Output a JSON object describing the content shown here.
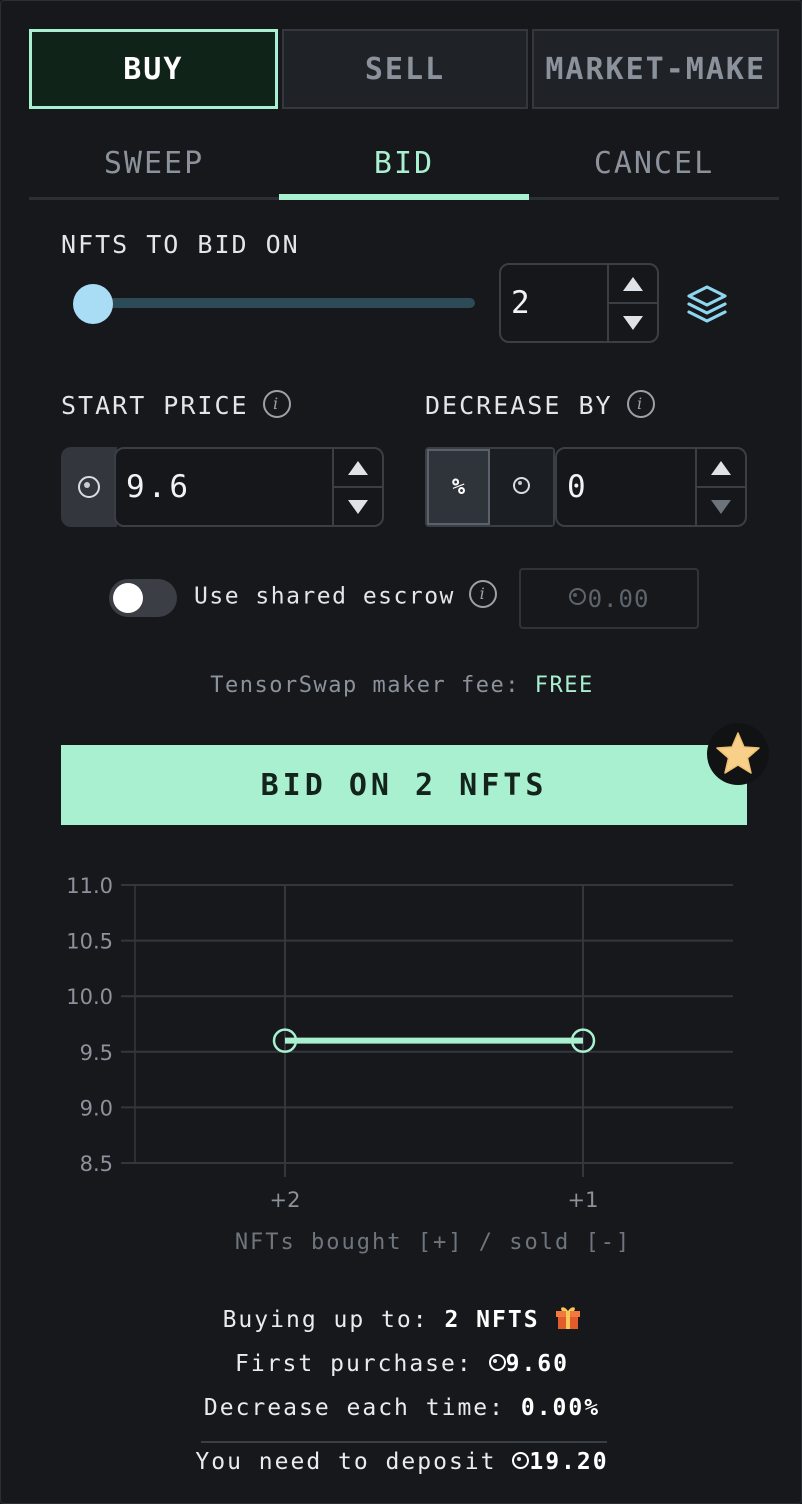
{
  "mode_tabs": [
    {
      "label": "BUY",
      "active": true
    },
    {
      "label": "SELL",
      "active": false
    },
    {
      "label": "MARKET-MAKE",
      "active": false
    }
  ],
  "sub_tabs": [
    {
      "label": "SWEEP",
      "active": false
    },
    {
      "label": "BID",
      "active": true
    },
    {
      "label": "CANCEL",
      "active": false
    }
  ],
  "nfts_to_bid": {
    "label": "NFTS TO BID ON",
    "value": "2",
    "slider_fraction": 0.0
  },
  "start_price": {
    "label": "START PRICE",
    "currency_icon": "sol-icon",
    "value": "9.6"
  },
  "decrease_by": {
    "label": "DECREASE BY",
    "percent_option": "%",
    "selected": "%",
    "value": "0"
  },
  "escrow": {
    "label": "Use shared escrow",
    "enabled": false,
    "placeholder": "0.00"
  },
  "fee": {
    "prefix": "TensorSwap maker fee:",
    "value": "FREE"
  },
  "bid_button": {
    "label": "BID ON 2 NFTS"
  },
  "colors": {
    "accent": "#a8f0d0",
    "background": "#16181b",
    "slider_thumb": "#a9ddf5",
    "star": "#f8d08a"
  },
  "chart_data": {
    "type": "line",
    "categories": [
      "+2",
      "+1"
    ],
    "series": [
      {
        "values": [
          9.6,
          9.6
        ]
      }
    ],
    "yticks": [
      "11.0",
      "10.5",
      "10.0",
      "9.5",
      "9.0",
      "8.5"
    ],
    "ylim": [
      8.5,
      11.0
    ],
    "xlabel": "NFTs bought [+] / sold [-]",
    "ylabel": "",
    "grid": true
  },
  "summary": {
    "buying_label": "Buying up to:",
    "buying_value": "2 NFTS",
    "first_label": "First purchase:",
    "first_value": "9.60",
    "decrease_label": "Decrease each time:",
    "decrease_value": "0.00%",
    "deposit_label": "You need to deposit",
    "deposit_value": "19.20"
  }
}
